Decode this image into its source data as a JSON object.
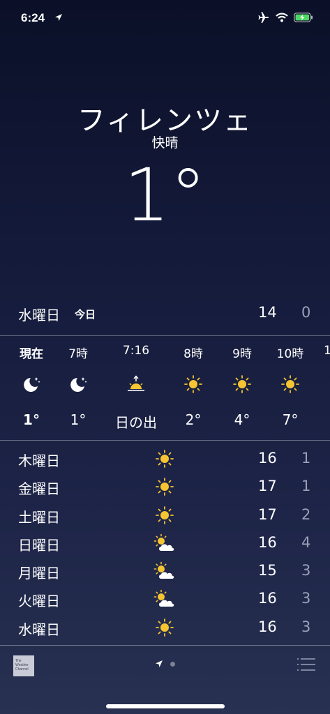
{
  "status_bar": {
    "time": "6:24",
    "icons": [
      "location-arrow-icon",
      "airplane-icon",
      "wifi-icon",
      "battery-charging-icon"
    ]
  },
  "location": {
    "city": "フィレンツェ",
    "condition": "快晴",
    "temperature": "1°"
  },
  "today": {
    "day": "水曜日",
    "label": "今日",
    "high": "14",
    "low": "0"
  },
  "hourly": [
    {
      "time": "現在",
      "icon": "moon-stars-icon",
      "temp": "1°"
    },
    {
      "time": "7時",
      "icon": "moon-stars-icon",
      "temp": "1°"
    },
    {
      "time": "7:16",
      "icon": "sunrise-icon",
      "temp": "日の出"
    },
    {
      "time": "8時",
      "icon": "sun-icon",
      "temp": "2°"
    },
    {
      "time": "9時",
      "icon": "sun-icon",
      "temp": "4°"
    },
    {
      "time": "10時",
      "icon": "sun-icon",
      "temp": "7°"
    },
    {
      "time": "1",
      "icon": "",
      "temp": ""
    }
  ],
  "daily": [
    {
      "day": "木曜日",
      "icon": "sun-icon",
      "high": "16",
      "low": "1"
    },
    {
      "day": "金曜日",
      "icon": "sun-icon",
      "high": "17",
      "low": "1"
    },
    {
      "day": "土曜日",
      "icon": "sun-icon",
      "high": "17",
      "low": "2"
    },
    {
      "day": "日曜日",
      "icon": "partly-cloudy-icon",
      "high": "16",
      "low": "4"
    },
    {
      "day": "月曜日",
      "icon": "partly-cloudy-icon",
      "high": "15",
      "low": "3"
    },
    {
      "day": "火曜日",
      "icon": "partly-cloudy-icon",
      "high": "16",
      "low": "3"
    },
    {
      "day": "水曜日",
      "icon": "sun-icon",
      "high": "16",
      "low": "3"
    }
  ],
  "bottom_bar": {
    "logo_text": "The Weather Channel"
  },
  "colors": {
    "sun": "#f6c531",
    "low_temp": "#9aa0b8",
    "battery": "#4cd964"
  }
}
